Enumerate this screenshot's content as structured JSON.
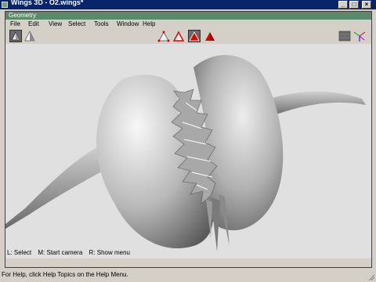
{
  "window": {
    "title": "Wings 3D - O2.wings*"
  },
  "geometry_window": {
    "title": "Geometry"
  },
  "menu": [
    "File",
    "Edit",
    "View",
    "Select",
    "Tools",
    "Window",
    "Help"
  ],
  "toolbar": {
    "selection_modes": [
      "vertex-mode-icon",
      "edge-mode-icon",
      "face-mode-icon",
      "body-mode-icon"
    ],
    "active_mode": "face-mode-icon"
  },
  "info_line": {
    "left": "L: Select",
    "middle": "M: Start camera",
    "right": "R: Show menu"
  },
  "status_bar": {
    "text": "For Help, click Help Topics on the Help Menu."
  },
  "colors": {
    "accent_red": "#e00000",
    "titlebar": "#0a246a",
    "geometry_titlebar": "#5a8a6a",
    "viewport_bg": "#e0e0e0"
  }
}
